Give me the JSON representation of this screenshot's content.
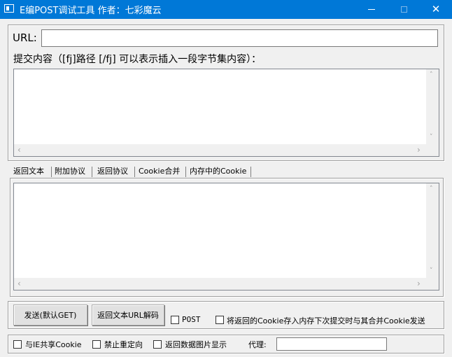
{
  "window": {
    "title": "E编POST调试工具 作者：七彩魔云",
    "icons": {
      "app": "app-window-icon",
      "minimize": "minimize-icon",
      "maximize": "maximize-icon",
      "close": "close-icon"
    },
    "close_glyph": "✕"
  },
  "url": {
    "label": "URL:",
    "value": ""
  },
  "body_label": "提交内容（[fj]路径 [/fj] 可以表示插入一段字节集内容）：",
  "body_value": "",
  "tabs": [
    {
      "label": "返回文本",
      "selected": true
    },
    {
      "label": "附加协议",
      "selected": false
    },
    {
      "label": "返回协议",
      "selected": false
    },
    {
      "label": "Cookie合并",
      "selected": false
    },
    {
      "label": "内存中的Cookie",
      "selected": false
    }
  ],
  "response_value": "",
  "scroll_arrows": {
    "up": "˄",
    "down": "˅",
    "left": "‹",
    "right": "›"
  },
  "buttons": {
    "send": "发送(默认GET)",
    "decode": "返回文本URL解码"
  },
  "options": {
    "post": {
      "label": "POST",
      "checked": false
    },
    "save_cookie": {
      "label": "将返回的Cookie存入内存下次提交时与其合并Cookie发送",
      "checked": false
    },
    "share_ie_cookie": {
      "label": "与IE共享Cookie",
      "checked": false
    },
    "no_redirect": {
      "label": "禁止重定向",
      "checked": false
    },
    "show_image": {
      "label": "返回数据图片显示",
      "checked": false
    }
  },
  "proxy": {
    "label": "代理:",
    "value": ""
  },
  "colors": {
    "titlebar": "#0078d7",
    "window_bg": "#f0f0f0"
  }
}
